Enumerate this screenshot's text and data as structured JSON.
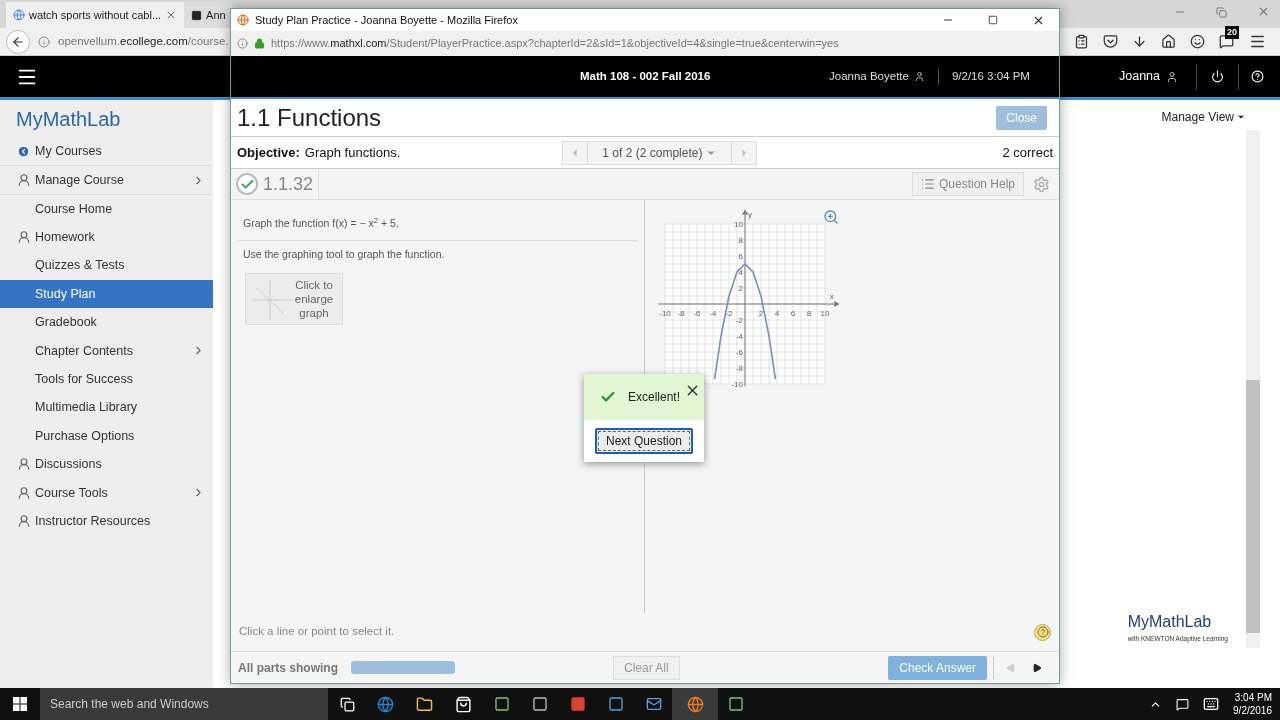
{
  "browser": {
    "tabs": [
      {
        "title": "watch sports without cabl...",
        "selected": true
      },
      {
        "title": "Ann",
        "selected": false
      }
    ],
    "url": {
      "host": "openvellum.",
      "domain": "ecollege.com",
      "path": "/course."
    },
    "badge": "20"
  },
  "site": {
    "logo": "MyMathLab",
    "user": "Joanna",
    "manage_view": "Manage View"
  },
  "sidebar": {
    "items": [
      {
        "label": "My Courses",
        "kind": "back",
        "selected": false,
        "expandable": false
      },
      {
        "label": "Manage Course",
        "kind": "section",
        "selected": false,
        "expandable": true
      },
      {
        "label": "Course Home",
        "kind": "link",
        "selected": false,
        "expandable": false
      },
      {
        "label": "Homework",
        "kind": "section",
        "selected": false,
        "expandable": false
      },
      {
        "label": "Quizzes & Tests",
        "kind": "link",
        "selected": false,
        "expandable": false
      },
      {
        "label": "Study Plan",
        "kind": "link",
        "selected": true,
        "expandable": false
      },
      {
        "label": "Gradebook",
        "kind": "link",
        "selected": false,
        "expandable": false
      },
      {
        "label": "Chapter Contents",
        "kind": "link",
        "selected": false,
        "expandable": true
      },
      {
        "label": "Tools for Success",
        "kind": "link",
        "selected": false,
        "expandable": false
      },
      {
        "label": "Multimedia Library",
        "kind": "link",
        "selected": false,
        "expandable": false
      },
      {
        "label": "Purchase Options",
        "kind": "link",
        "selected": false,
        "expandable": false
      },
      {
        "label": "Discussions",
        "kind": "section",
        "selected": false,
        "expandable": false
      },
      {
        "label": "Course Tools",
        "kind": "section",
        "selected": false,
        "expandable": true
      },
      {
        "label": "Instructor Resources",
        "kind": "section",
        "selected": false,
        "expandable": false
      }
    ]
  },
  "popup": {
    "title": "Study Plan Practice - Joanna Boyette - Mozilla Firefox",
    "url": {
      "scheme": "https://www.",
      "domain": "mathxl.com",
      "path": "/Student/PlayerPractice.aspx?chapterId=2&sId=1&objectiveId=4&single=true&centerwin=yes"
    },
    "course": "Math 108 - 002 Fall 2016",
    "user": "Joanna Boyette",
    "datetime": "9/2/16 3:04 PM",
    "heading": "1.1 Functions",
    "close": "Close",
    "objective_label": "Objective:",
    "objective": "Graph functions.",
    "pager": "1 of 2 (2 complete)",
    "score": "2 correct",
    "question_number": "1.1.32",
    "question_correct": true,
    "question_help": "Question Help",
    "prompt": "Graph the function f(x) = − x$^{2}$ + 5.",
    "instruction": "Use the graphing tool to graph the function.",
    "enlarge": "Click to enlarge graph",
    "graph": {
      "chart_data": {
        "type": "line",
        "xlabel": "x",
        "ylabel": "y",
        "x": [
          -3.8,
          -3,
          -2,
          -1,
          0,
          1,
          2,
          3,
          3.8
        ],
        "grid": true,
        "series": [
          {
            "color": "#7b8cc4",
            "values": [
              -9.4,
              -4,
              1,
              4,
              5,
              4,
              1,
              -4,
              -9.4
            ]
          }
        ],
        "xlim": [
          -10,
          10
        ],
        "ylim": [
          -10,
          10
        ],
        "xticks": [
          -10,
          -8,
          -6,
          -4,
          -2,
          2,
          4,
          6,
          8,
          10
        ],
        "yticks": [
          -10,
          -8,
          -6,
          -4,
          -2,
          2,
          4,
          6,
          8,
          10
        ]
      }
    },
    "feedback": {
      "message": "Excellent!",
      "button": "Next Question"
    },
    "hint": "Click a line or point to select it.",
    "parts": "All parts showing",
    "progress": {
      "level": 1
    },
    "clear": "Clear All",
    "check": "Check Answer"
  },
  "footer_logo": {
    "name": "MyMathLab",
    "tagline": "with KNEWTON Adaptive Learning"
  },
  "taskbar": {
    "search": "Search the web and Windows",
    "time": "3:04 PM",
    "date": "9/2/2016"
  }
}
